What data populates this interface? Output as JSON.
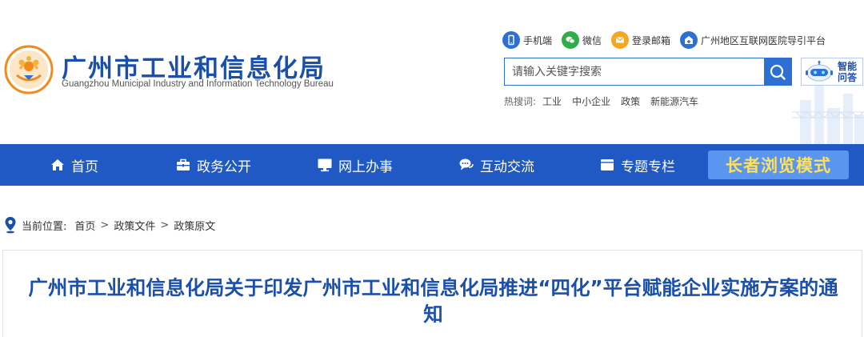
{
  "header": {
    "logo_title": "广州市工业和信息化局",
    "logo_subtitle": "Guangzhou Municipal Industry and Information Technology Bureau",
    "quick_links": [
      {
        "label": "手机端",
        "icon": "phone-icon",
        "color": "#2d6fd3"
      },
      {
        "label": "微信",
        "icon": "wechat-icon",
        "color": "#2eae4a"
      },
      {
        "label": "登录邮箱",
        "icon": "mail-icon",
        "color": "#f5a623"
      },
      {
        "label": "广州地区互联网医院导引平台",
        "icon": "hospital-icon",
        "color": "#2d6fd3"
      }
    ],
    "search": {
      "placeholder": "请输入关键字搜索",
      "value": ""
    },
    "ai": {
      "label_line1": "智能",
      "label_line2": "问答"
    },
    "hot": {
      "label": "热搜词:",
      "words": [
        "工业",
        "中小企业",
        "政策",
        "新能源汽车"
      ]
    }
  },
  "nav": {
    "items": [
      {
        "label": "首页",
        "icon": "home-icon"
      },
      {
        "label": "政务公开",
        "icon": "briefcase-icon"
      },
      {
        "label": "网上办事",
        "icon": "monitor-icon"
      },
      {
        "label": "互动交流",
        "icon": "chat-icon"
      },
      {
        "label": "专题专栏",
        "icon": "folder-icon"
      }
    ],
    "elder_mode": "长者浏览模式"
  },
  "breadcrumb": {
    "label": "当前位置:",
    "items": [
      "首页",
      "政策文件",
      "政策原文"
    ],
    "separator": ">"
  },
  "article": {
    "title": "广州市工业和信息化局关于印发广州市工业和信息化局推进“四化”平台赋能企业实施方案的通知"
  },
  "colors": {
    "primary": "#2059c3",
    "title_blue": "#1a4faa",
    "elder_bg": "#5a96f0",
    "elder_text": "#ffe15a"
  }
}
